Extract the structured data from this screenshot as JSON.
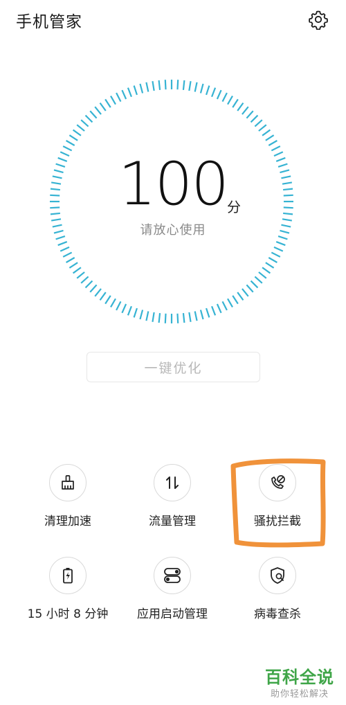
{
  "header": {
    "title": "手机管家",
    "settings_icon": "gear-icon"
  },
  "score": {
    "value": "100",
    "unit": "分",
    "status": "请放心使用",
    "ring_color": "#36b3d3"
  },
  "optimize_button": {
    "label": "一键优化"
  },
  "tools": [
    {
      "label": "清理加速",
      "icon": "broom-icon"
    },
    {
      "label": "流量管理",
      "icon": "data-arrows-icon"
    },
    {
      "label": "骚扰拦截",
      "icon": "blocked-call-icon",
      "highlighted": true
    },
    {
      "label": "15 小时 8 分钟",
      "icon": "battery-icon"
    },
    {
      "label": "应用启动管理",
      "icon": "app-launch-toggles-icon"
    },
    {
      "label": "病毒查杀",
      "icon": "shield-search-icon"
    }
  ],
  "highlight_color": "#f0923a",
  "watermark": {
    "main": "百科全说",
    "sub": "助你轻松解决",
    "color": "#3fa548"
  }
}
